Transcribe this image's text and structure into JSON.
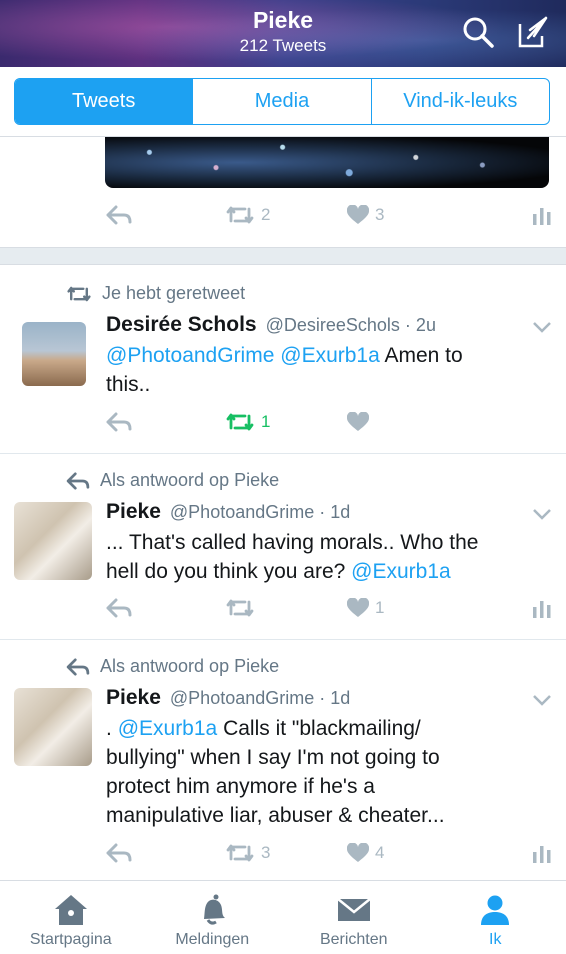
{
  "header": {
    "title": "Pieke",
    "subtitle": "212 Tweets"
  },
  "tabs": [
    {
      "label": "Tweets",
      "active": true
    },
    {
      "label": "Media",
      "active": false
    },
    {
      "label": "Vind-ik-leuks",
      "active": false
    }
  ],
  "partial_tweet": {
    "retweets": "2",
    "likes": "3"
  },
  "tweets": [
    {
      "social": "Je hebt geretweet",
      "name": "Desirée Schols",
      "meta": "@DesireeSchols · 2u",
      "mention1": "@PhotoandGrime",
      "mention2": "@Exurb1a",
      "text": "Amen to",
      "text2": "this..",
      "retweets": "1",
      "likes": ""
    },
    {
      "social": "Als antwoord op Pieke",
      "name": "Pieke",
      "meta": "@PhotoandGrime · 1d",
      "text": "... That's called having morals.. Who the",
      "text2": "hell do you think you are?",
      "mention": "@Exurb1a",
      "retweets": "",
      "likes": "1"
    },
    {
      "social": "Als antwoord op Pieke",
      "name": "Pieke",
      "meta": "@PhotoandGrime · 1d",
      "prefix": ".",
      "mention": "@Exurb1a",
      "text": "Calls it \"blackmailing/",
      "line2": "bullying\" when I say I'm not going to",
      "line3": "protect him anymore if he's a",
      "line4": "manipulative liar, abuser & cheater...",
      "retweets": "3",
      "likes": "4"
    }
  ],
  "nav": [
    {
      "label": "Startpagina",
      "icon": "home-icon"
    },
    {
      "label": "Meldingen",
      "icon": "bell-icon"
    },
    {
      "label": "Berichten",
      "icon": "envelope-icon"
    },
    {
      "label": "Ik",
      "icon": "person-icon",
      "active": true
    }
  ],
  "colors": {
    "accent": "#1da1f2",
    "retweet_green": "#17bf63",
    "muted": "#aab8c2"
  }
}
